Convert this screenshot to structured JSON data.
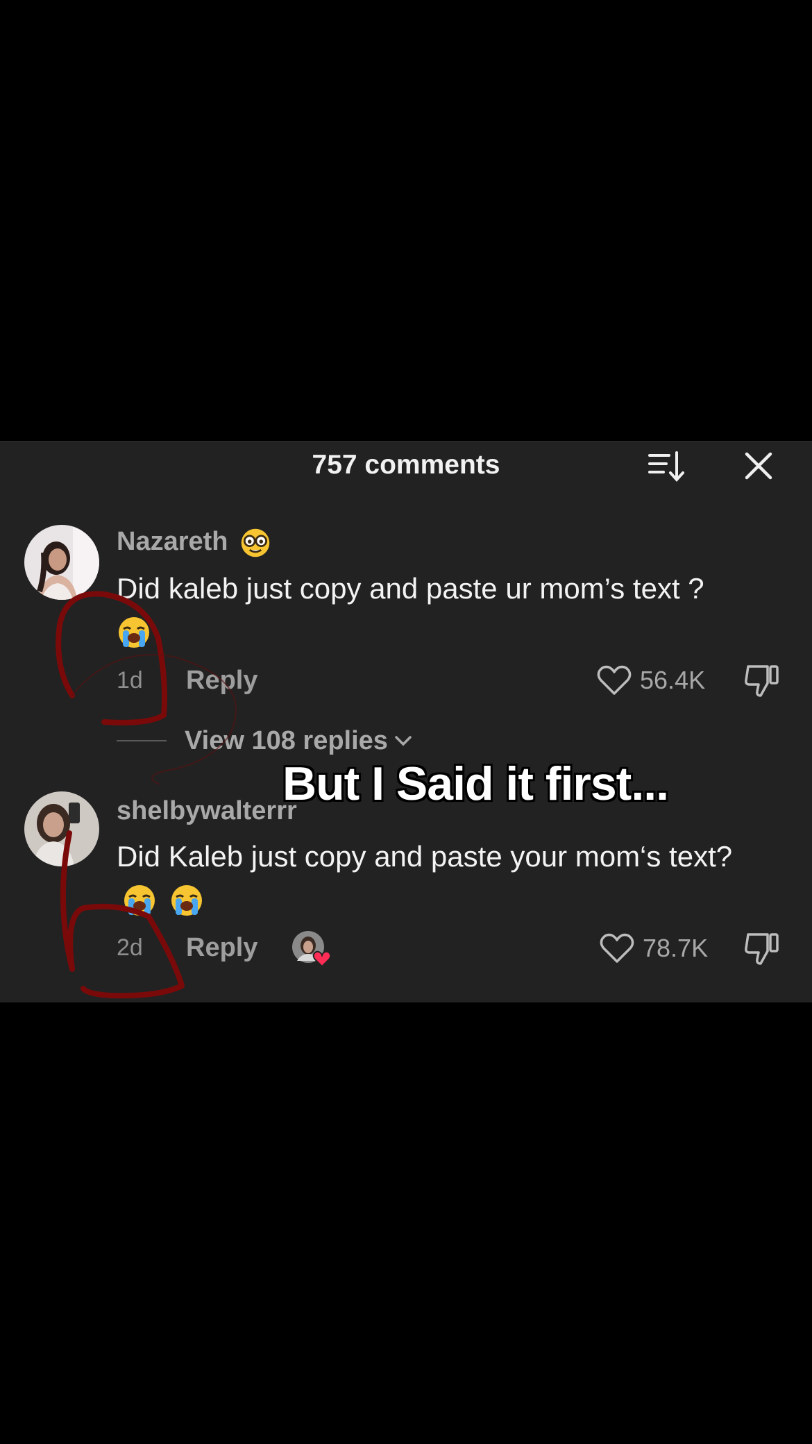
{
  "header": {
    "title": "757 comments",
    "sort_icon": "sort-icon",
    "close_icon": "close-icon"
  },
  "comments": [
    {
      "username": "Nazareth",
      "username_emoji": "nerd-face-emoji",
      "text": "Did kaleb just copy and paste ur mom’s text ?",
      "text_emoji": "loudly-crying-face-emoji",
      "time": "1d",
      "reply_label": "Reply",
      "likes": "56.4K"
    },
    {
      "username": "shelbywalterrr",
      "text": "Did Kaleb just copy and paste your mom‘s text?",
      "text_emoji": "loudly-crying-face-emoji",
      "time": "2d",
      "reply_label": "Reply",
      "likes": "78.7K",
      "creator_liked": true
    }
  ],
  "view_replies": {
    "label": "View 108 replies"
  },
  "overlay": {
    "caption": "But I Said it first..."
  },
  "colors": {
    "panel": "#222222",
    "background": "#000000",
    "scribble": "#7a0a0a",
    "heart_badge": "#ff2d55"
  }
}
